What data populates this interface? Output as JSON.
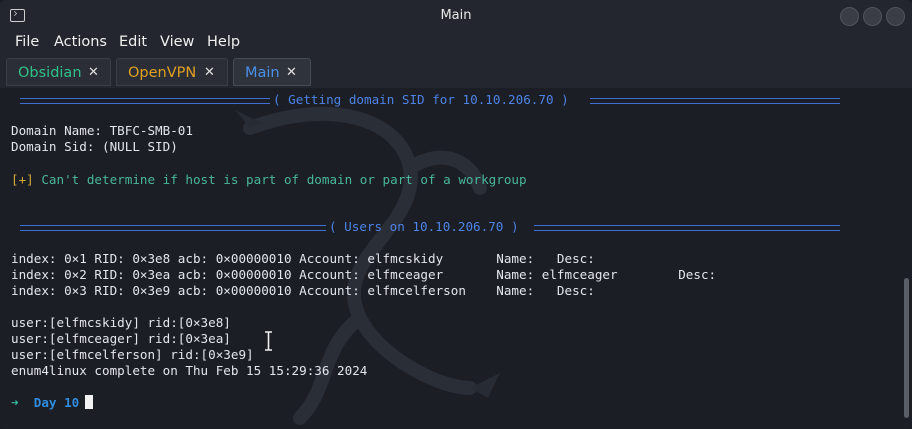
{
  "window": {
    "title": "Main",
    "icon": "terminal-icon"
  },
  "menu": [
    "File",
    "Actions",
    "Edit",
    "View",
    "Help"
  ],
  "tabs": [
    {
      "label": "Obsidian",
      "color": "#2fc08a",
      "active": false
    },
    {
      "label": "OpenVPN",
      "color": "#e0a020",
      "active": false
    },
    {
      "label": "Main",
      "color": "#4a8fe7",
      "active": true
    }
  ],
  "terminal": {
    "sep1": "( Getting domain SID for 10.10.206.70 )",
    "domain_name": "Domain Name: TBFC-SMB-01",
    "domain_sid": "Domain Sid: (NULL SID)",
    "warn_tag": "[+]",
    "warn_text": " Can't determine if host is part of domain or part of a workgroup",
    "sep2": "( Users on 10.10.206.70 )",
    "users": [
      "index: 0×1 RID: 0×3e8 acb: 0×00000010 Account: elfmcskidy       Name:   Desc:",
      "index: 0×2 RID: 0×3ea acb: 0×00000010 Account: elfmceager       Name: elfmceager        Desc:",
      "index: 0×3 RID: 0×3e9 acb: 0×00000010 Account: elfmcelferson    Name:   Desc:"
    ],
    "rids": [
      "user:[elfmcskidy] rid:[0×3e8]",
      "user:[elfmceager] rid:[0×3ea]",
      "user:[elfmcelferson] rid:[0×3e9]"
    ],
    "complete": "enum4linux complete on Thu Feb 15 15:29:36 2024",
    "prompt_arrow": "➜",
    "prompt_dir": "Day 10"
  }
}
